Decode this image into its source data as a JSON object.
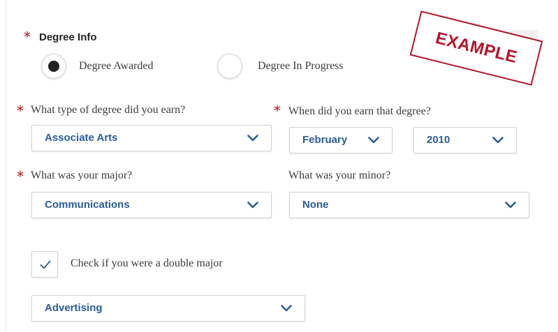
{
  "degree_info": {
    "label": "Degree Info",
    "required_mark": "*",
    "options": [
      {
        "label": "Degree Awarded",
        "selected": true
      },
      {
        "label": "Degree In Progress",
        "selected": false
      }
    ]
  },
  "degree_type": {
    "label": "What type of degree did you earn?",
    "required_mark": "*",
    "value": "Associate Arts"
  },
  "earned_date": {
    "label": "When did you earn that degree?",
    "required_mark": "*",
    "month": "February",
    "year": "2010"
  },
  "major": {
    "label": "What was your major?",
    "required_mark": "*",
    "value": "Communications"
  },
  "minor": {
    "label": "What was your minor?",
    "value": "None"
  },
  "double_major": {
    "label": "Check if you were a double major",
    "checked": true,
    "value": "Advertising"
  },
  "stamp": {
    "text": "EXAMPLE"
  },
  "colors": {
    "required": "#b5121b",
    "select_text": "#2a5d9a",
    "chevron": "#2a5d9a",
    "stamp": "#b3152a"
  },
  "icons": {
    "dropdown": "chevron-down-icon",
    "check": "checkmark-icon"
  }
}
